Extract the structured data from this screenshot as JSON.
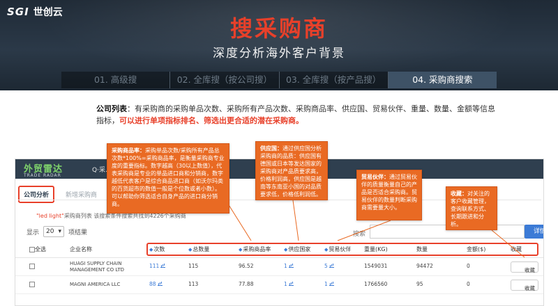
{
  "logo": {
    "mark": "SGI",
    "name": "世创云"
  },
  "hero": {
    "title": "搜采购商",
    "subtitle": "深度分析海外客户背景",
    "steps": [
      "01. 高级搜",
      "02. 全库搜（按公司搜）",
      "03. 全库搜（按产品搜）",
      "04. 采购商搜索"
    ],
    "active_step": 3
  },
  "description": {
    "lead": "公司列表",
    "body": "：有采购商的采购单品次数、采购所有产品次数、采购商品率、供应国、贸易伙伴、重量、数量、金额等信息指标，",
    "highlight": "可以进行单项指标排名、筛选出更合适的潜在采购商。"
  },
  "app": {
    "brand_cn": "外贸雷达",
    "brand_en": "TRADE RADAR",
    "nav_label": "Q·采…",
    "tabs": [
      "公司分析",
      "新增采购商"
    ],
    "result_query": "\"led light\"",
    "result_note": "采购商列表 该搜索条件搜索共找到4226个采购商",
    "show_label": "显示",
    "page_size": "20",
    "show_suffix": "项结果",
    "search_label": "搜索",
    "detail_button": "详情",
    "columns": [
      "全选",
      "企业名称",
      "次数",
      "总数量",
      "采购商品率",
      "供应国家",
      "贸易伙伴",
      "重量(KG)",
      "数量",
      "金额($)",
      "收藏"
    ],
    "rows": [
      {
        "name": "HUAGI SUPPLY CHAIN MANAGEMENT CO LTD",
        "times": "111",
        "total": "115",
        "rate": "96.52",
        "countries": "1",
        "partners": "5",
        "weight": "1549031",
        "qty": "94472",
        "amount": "0",
        "fav": "收藏"
      },
      {
        "name": "MAGNI AMERICA LLC",
        "times": "88",
        "total": "113",
        "rate": "77.88",
        "countries": "1",
        "partners": "1",
        "weight": "1766560",
        "qty": "95",
        "amount": "0",
        "fav": "收藏"
      }
    ]
  },
  "callouts": [
    {
      "title": "采购商品率：",
      "text": "采购单品次数/采购所有产品总次数*100%=采购商品率，是衡量采购商专业度的重要指标。数字越高（30以上数值），代表采购商是专业的单品进口商和分销商，数字越低代表客户是综合商品进口商（如沃尔玛类的百货超市的数值一般是个位数或者小数）。可以帮助你筛选适合自身产品的进口商分销商。"
    },
    {
      "title": "供应国：",
      "text": "通过供应国分析采购商的品质：供应国有德国或日本等发达国家的采购商对产品质要求高，价格利润高，供应国是越南等东南亚小国的对品质要求低，价格低利润低。"
    },
    {
      "title": "贸易伙伴：",
      "text": "通过贸易伙伴的质量衡量自己的产品是否适合采购商。贸易伙伴的数量判断采购商需要量大小。"
    },
    {
      "title": "收藏：",
      "text": "对关注的客户收藏管理，查询联系方式、长期跟进和分析。"
    }
  ],
  "colors": {
    "accent": "#e8402a",
    "callout": "#e96a23",
    "link": "#3c7bd6",
    "topbar": "#2f3f4f"
  }
}
